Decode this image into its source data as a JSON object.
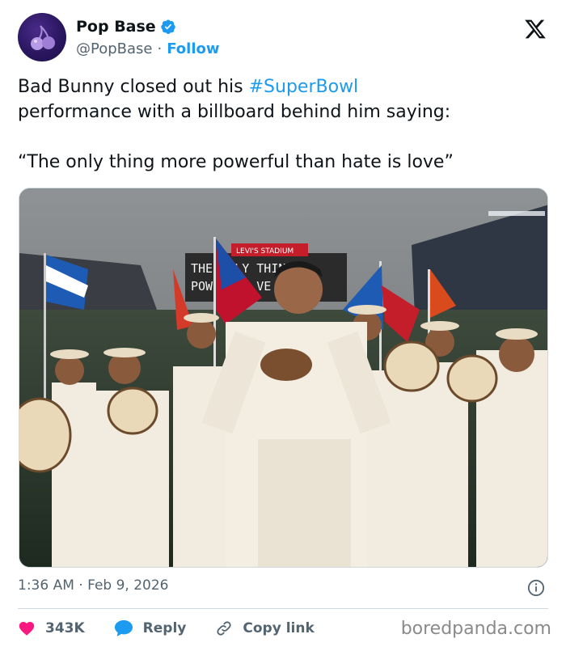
{
  "author": {
    "name": "Pop Base",
    "handle": "@PopBase",
    "separator": "·",
    "follow_label": "Follow",
    "avatar_icon": "cherries-icon",
    "verified_color": "#1d9bf0"
  },
  "tweet": {
    "line1_prefix": "Bad Bunny closed out his ",
    "hashtag": "#SuperBowl",
    "line2": "performance with a billboard behind him saying:",
    "quote": "“The only thing more powerful than hate is love”"
  },
  "media": {
    "billboard_top": "LEVI'S STADIUM",
    "billboard_line1": "THE ONLY THING",
    "billboard_line2": "POW  THAN  VE"
  },
  "meta": {
    "time": "1:36 AM",
    "separator": "·",
    "date": "Feb 9, 2026"
  },
  "actions": {
    "likes": "343K",
    "reply": "Reply",
    "copy_link": "Copy link"
  },
  "watermark": "boredpanda.com",
  "colors": {
    "accent": "#1d9bf0",
    "like": "#f91880",
    "text": "#0f1419",
    "muted": "#536471"
  }
}
